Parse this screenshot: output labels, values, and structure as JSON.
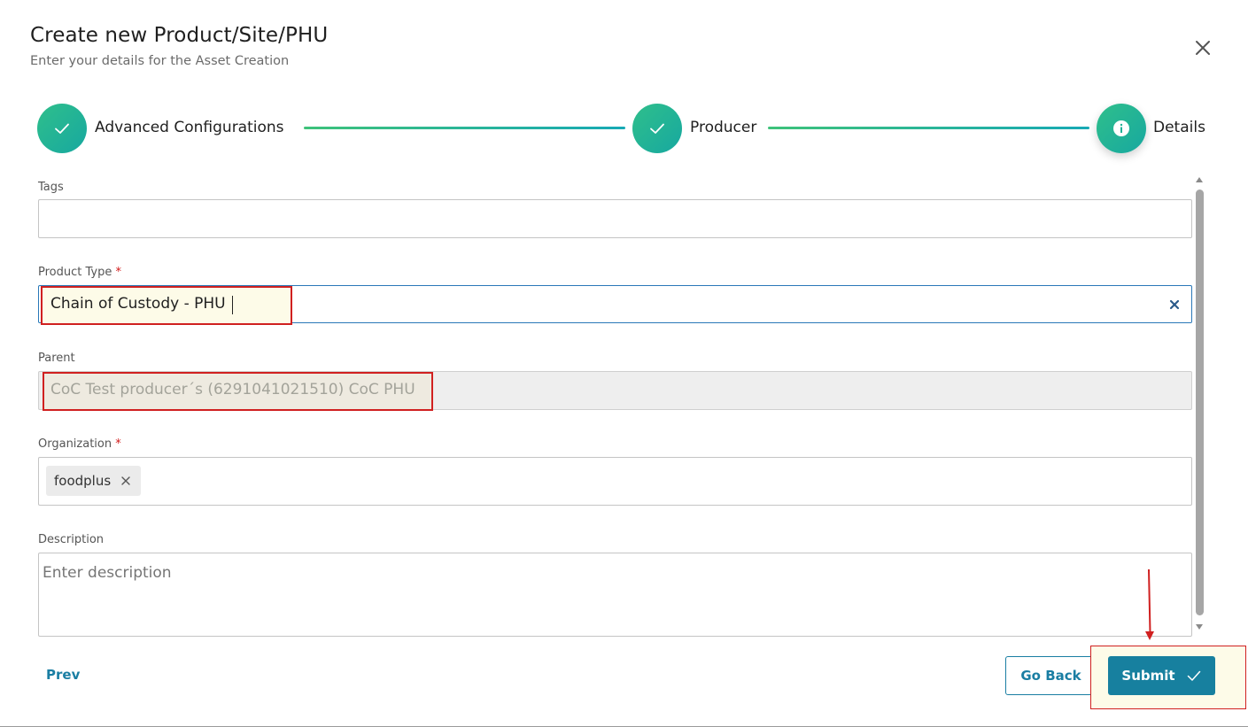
{
  "header": {
    "title": "Create new Product/Site/PHU",
    "subtitle": "Enter your details for the Asset Creation"
  },
  "stepper": {
    "steps": [
      {
        "label": "Advanced Configurations",
        "status": "completed"
      },
      {
        "label": "Producer",
        "status": "completed"
      },
      {
        "label": "Details",
        "status": "active"
      }
    ]
  },
  "form": {
    "tags": {
      "label": "Tags",
      "value": ""
    },
    "product_type": {
      "label": "Product Type",
      "required_mark": "*",
      "value": "Chain of Custody - PHU"
    },
    "parent": {
      "label": "Parent",
      "value": "CoC Test producer´s (6291041021510) CoC PHU"
    },
    "organization": {
      "label": "Organization",
      "required_mark": "*",
      "chips": [
        "foodplus"
      ]
    },
    "description": {
      "label": "Description",
      "placeholder": "Enter description",
      "value": ""
    }
  },
  "footer": {
    "prev_label": "Prev",
    "go_back_label": "Go Back",
    "submit_label": "Submit"
  },
  "colors": {
    "accent": "#17809f",
    "step_gradient_start": "#2fbf8b",
    "step_gradient_end": "#17a8a0",
    "highlight": "#d02020",
    "required": "#d11a1a"
  }
}
